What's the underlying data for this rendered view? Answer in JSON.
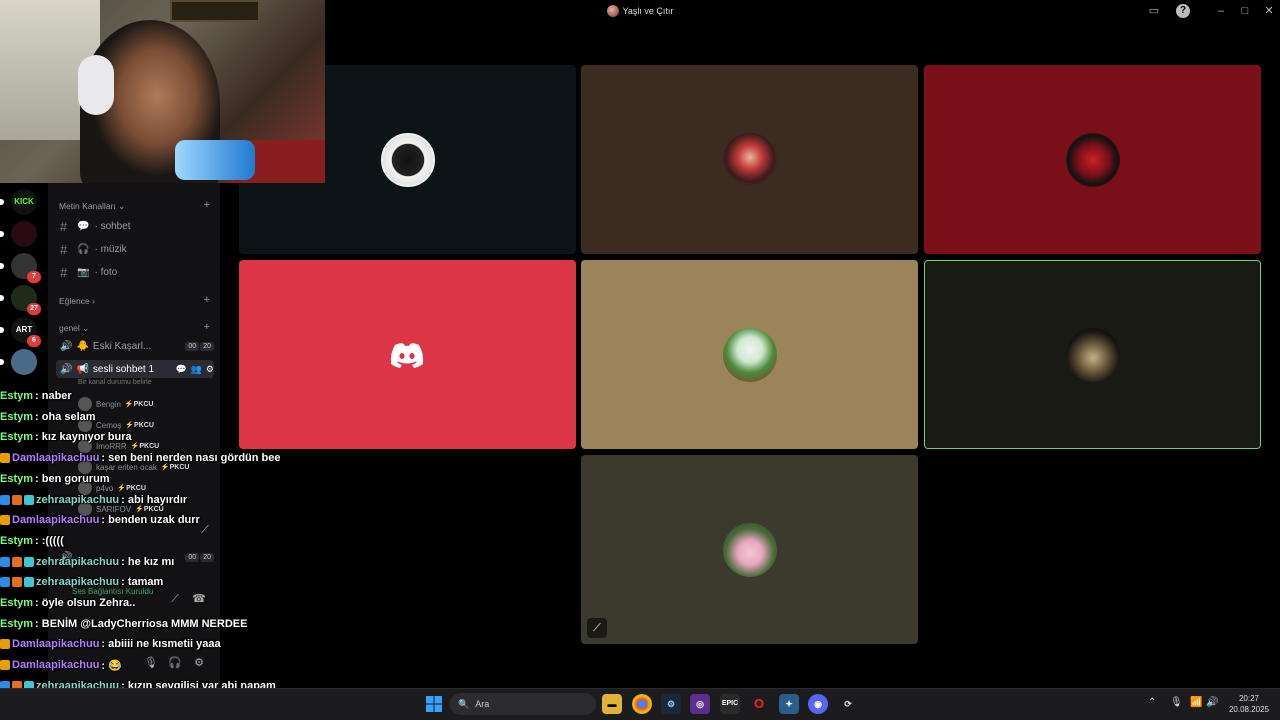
{
  "window": {
    "title": "Yaşlı ve Çıtır"
  },
  "sidebar": {
    "text_category": "Metin Kanalları",
    "text_channels": [
      {
        "emoji": "💬",
        "name": "sohbet"
      },
      {
        "emoji": "🎧",
        "name": "müzik"
      },
      {
        "emoji": "📷",
        "name": "foto"
      }
    ],
    "cat_fun": "Eğlence",
    "cat_general": "genel",
    "voice_channels": [
      {
        "name": "Eski Kaşarl...",
        "count_a": "00",
        "count_b": "20"
      },
      {
        "name": "sesli sohbet 1",
        "status": "Bir kanal durumu belirle"
      }
    ],
    "members": [
      {
        "name": "Bengin",
        "tag": "⚡PKCU"
      },
      {
        "name": "Cemoş",
        "tag": "⚡PKCU"
      },
      {
        "name": "ImoRRR",
        "tag": "⚡PKCU"
      },
      {
        "name": "kaşar eriten ocak",
        "tag": "⚡PKCU"
      },
      {
        "name": "p4vo",
        "tag": "⚡PKCU"
      },
      {
        "name": "SARIFOV",
        "tag": "⚡PKCU"
      }
    ],
    "lower_counts": {
      "a": "00",
      "b": "20"
    },
    "connection": "Ses Bağlantısı Kuruldu"
  },
  "rail": {
    "servers": [
      {
        "label": "KICK",
        "badge": ""
      },
      {
        "label": "",
        "badge": ""
      },
      {
        "label": "",
        "badge": "7"
      },
      {
        "label": "",
        "badge": "27"
      },
      {
        "label": "ART",
        "badge": "6"
      },
      {
        "label": "",
        "badge": ""
      }
    ]
  },
  "chat": {
    "messages": [
      {
        "user": "Estym",
        "color": "#7CFC7C",
        "text": ": naber",
        "badges": []
      },
      {
        "user": "Estym",
        "color": "#7CFC7C",
        "text": ": oha selam",
        "badges": []
      },
      {
        "user": "Estym",
        "color": "#7CFC7C",
        "text": ": kız kaynıyor bura",
        "badges": []
      },
      {
        "user": "Damlaapikachuu",
        "color": "#b47cff",
        "text": ": sen beni nerden nası gördün bee",
        "badges": [
          "#e5a000"
        ]
      },
      {
        "user": "Estym",
        "color": "#7CFC7C",
        "text": ": ben gorurum",
        "badges": []
      },
      {
        "user": "zehraapikachuu",
        "color": "#7cd9c9",
        "text": ": abi hayırdır",
        "badges": [
          "#2b8ce6",
          "#e56b1f",
          "#3ec7d0"
        ]
      },
      {
        "user": "Damlaapikachuu",
        "color": "#b47cff",
        "text": ": benden uzak durr",
        "badges": [
          "#e5a000"
        ]
      },
      {
        "user": "Estym",
        "color": "#7CFC7C",
        "text": ": :(((((",
        "badges": []
      },
      {
        "user": "zehraapikachuu",
        "color": "#7cd9c9",
        "text": ": he kız mı",
        "badges": [
          "#2b8ce6",
          "#e56b1f",
          "#3ec7d0"
        ]
      },
      {
        "user": "zehraapikachuu",
        "color": "#7cd9c9",
        "text": ": tamam",
        "badges": [
          "#2b8ce6",
          "#e56b1f",
          "#3ec7d0"
        ]
      },
      {
        "user": "Estym",
        "color": "#7CFC7C",
        "text": ": öyle olsun Zehra..",
        "badges": []
      },
      {
        "user": "Estym",
        "color": "#7CFC7C",
        "text": ": BENİM @LadyCherriosa MMM NERDEE",
        "badges": []
      },
      {
        "user": "Damlaapikachuu",
        "color": "#b47cff",
        "text": ": abiiii ne kısmetii yaaa",
        "badges": [
          "#e5a000"
        ]
      },
      {
        "user": "Damlaapikachuu",
        "color": "#b47cff",
        "text": ": 😂",
        "badges": [
          "#e5a000"
        ]
      },
      {
        "user": "zehraapikachuu",
        "color": "#7cd9c9",
        "text": ": kızın sevgilisi var abi napam",
        "badges": [
          "#2b8ce6",
          "#e56b1f",
          "#3ec7d0"
        ]
      }
    ]
  },
  "taskbar": {
    "search_placeholder": "Ara",
    "time": "20:27",
    "date": "20.08.2025"
  },
  "colors": {
    "tile_dark_teal": "#0b1416",
    "tile_brown": "#3b2b21",
    "tile_red": "#7a0f19",
    "tile_discord_red": "#dc3545",
    "tile_tan": "#9b845a",
    "tile_speaking_bg": "#1a1a14",
    "tile_speaking_border": "#6fcf7f",
    "tile_olive": "#3b3a2c"
  }
}
